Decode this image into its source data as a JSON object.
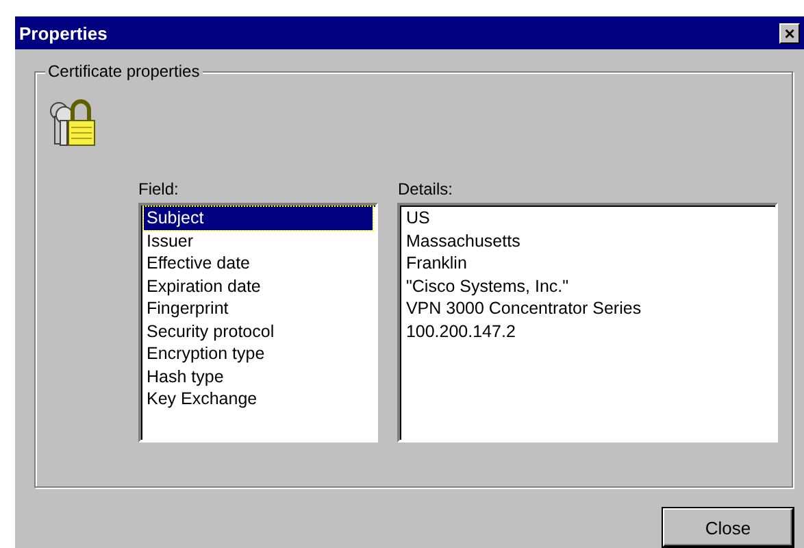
{
  "window": {
    "title": "Properties",
    "close_glyph": "×"
  },
  "group": {
    "title": "Certificate properties"
  },
  "field_list": {
    "label": "Field:",
    "items": [
      {
        "label": "Subject",
        "selected": true
      },
      {
        "label": "Issuer",
        "selected": false
      },
      {
        "label": "Effective date",
        "selected": false
      },
      {
        "label": "Expiration date",
        "selected": false
      },
      {
        "label": "Fingerprint",
        "selected": false
      },
      {
        "label": "Security protocol",
        "selected": false
      },
      {
        "label": "Encryption type",
        "selected": false
      },
      {
        "label": "Hash type",
        "selected": false
      },
      {
        "label": "Key Exchange",
        "selected": false
      }
    ]
  },
  "details": {
    "label": "Details:",
    "lines": [
      "US",
      "Massachusetts",
      "Franklin",
      "\"Cisco Systems, Inc.\"",
      "VPN 3000 Concentrator Series",
      "100.200.147.2"
    ]
  },
  "buttons": [
    "Close"
  ]
}
